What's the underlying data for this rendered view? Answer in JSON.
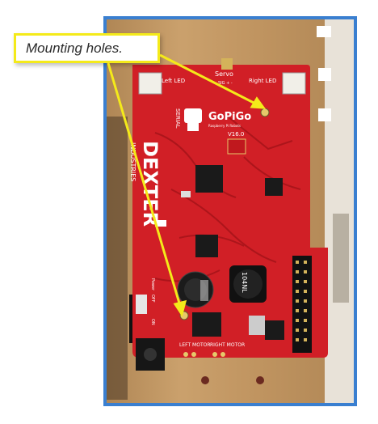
{
  "callout": {
    "text": "Mounting holes."
  },
  "board": {
    "logo": "GoPiGo",
    "tagline": "Raspberry Pi Robots",
    "version": "V16.0",
    "brand": "DEXTER",
    "brand_sub": "INDUSTRIES",
    "servo_label": "Servo",
    "servo_pins": "SIG + -",
    "left_led_label": "Left LED",
    "right_led_label": "Right LED",
    "serial_label": "SERIAL",
    "chip_label": "104NL",
    "left_motor_label": "LEFT MOTOR",
    "right_motor_label": "RIGHT MOTOR",
    "power_label": "Power",
    "on_label": "ON",
    "off_label": "OFF"
  },
  "colors": {
    "frame_border": "#3a7fd0",
    "callout_border": "#f4ea1a",
    "arrow": "#f4ea1a",
    "pcb": "#d11f26",
    "wood": "#c49a66"
  }
}
